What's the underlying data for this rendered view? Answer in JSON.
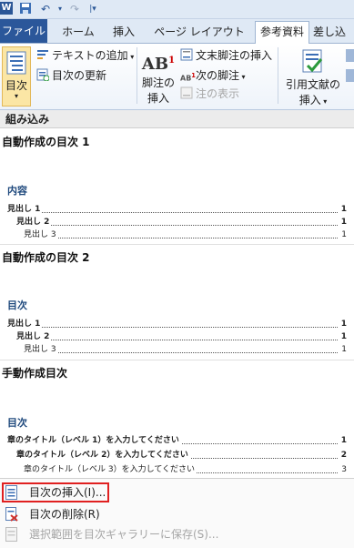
{
  "titlebar": {
    "logo": "W",
    "qat_undo": "↶",
    "qat_redo": "↷"
  },
  "tabs": [
    {
      "label": "ファイル"
    },
    {
      "label": "ホーム"
    },
    {
      "label": "挿入"
    },
    {
      "label": "ページ レイアウト"
    },
    {
      "label": "参考資料"
    },
    {
      "label": "差し込"
    }
  ],
  "ribbon": {
    "toc_button": "目次",
    "add_text": "テキストの追加",
    "update_toc": "目次の更新",
    "footnote_line1": "脚注の",
    "footnote_line2": "挿入",
    "endnote": "文末脚注の挿入",
    "next_footnote": "次の脚注",
    "show_notes": "注の表示",
    "citation_line1": "引用文献の",
    "citation_line2": "挿入"
  },
  "gallery": {
    "header": "組み込み",
    "items": [
      {
        "title": "自動作成の目次 1",
        "heading": "内容",
        "lines": [
          {
            "text": "見出し 1",
            "page": "1"
          },
          {
            "text": "見出し 2",
            "page": "1"
          },
          {
            "text": "見出し 3",
            "page": "1"
          }
        ]
      },
      {
        "title": "自動作成の目次 2",
        "heading": "目次",
        "lines": [
          {
            "text": "見出し 1",
            "page": "1"
          },
          {
            "text": "見出し 2",
            "page": "1"
          },
          {
            "text": "見出し 3",
            "page": "1"
          }
        ]
      },
      {
        "title": "手動作成目次",
        "heading": "目次",
        "lines": [
          {
            "text": "章のタイトル（レベル 1）を入力してください",
            "page": "1"
          },
          {
            "text": "章のタイトル（レベル 2）を入力してください",
            "page": "2"
          },
          {
            "text": "章のタイトル（レベル 3）を入力してください",
            "page": "3"
          }
        ]
      }
    ]
  },
  "menu": {
    "insert_toc": "目次の挿入(I)...",
    "remove_toc": "目次の削除(R)",
    "save_selection": "選択範囲を目次ギャラリーに保存(S)..."
  },
  "colors": {
    "accent": "#2b579a",
    "heading": "#1f497d",
    "highlight": "#e02020"
  }
}
